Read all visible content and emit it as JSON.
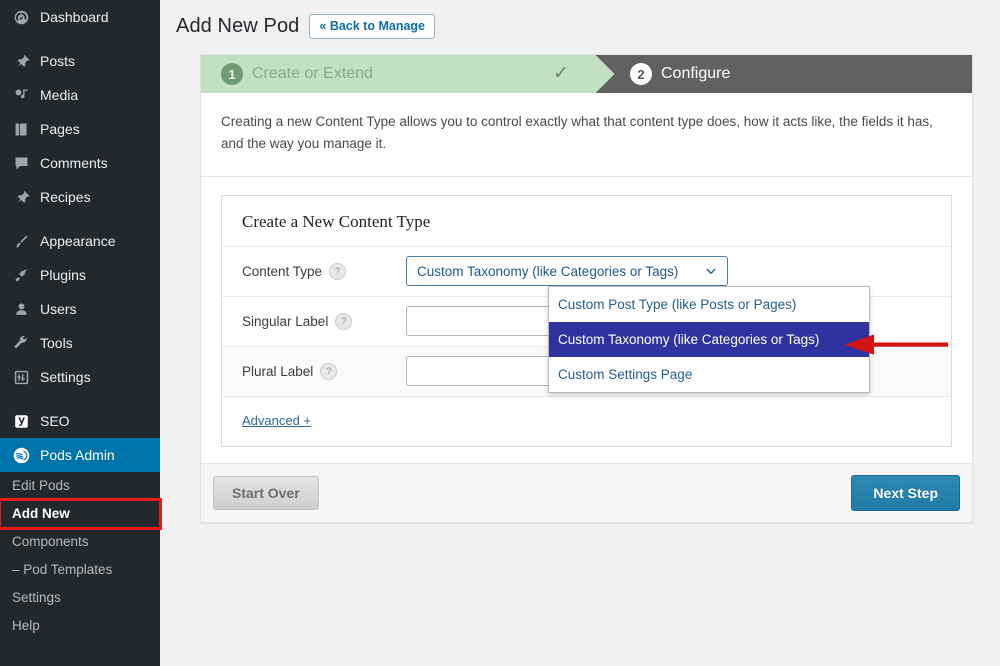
{
  "sidebar": {
    "items": [
      {
        "label": "Dashboard",
        "icon": "dashboard-icon"
      },
      {
        "label": "Posts",
        "icon": "pin-icon"
      },
      {
        "label": "Media",
        "icon": "media-icon"
      },
      {
        "label": "Pages",
        "icon": "pages-icon"
      },
      {
        "label": "Comments",
        "icon": "comment-icon"
      },
      {
        "label": "Recipes",
        "icon": "pin-icon"
      },
      {
        "label": "Appearance",
        "icon": "brush-icon"
      },
      {
        "label": "Plugins",
        "icon": "plug-icon"
      },
      {
        "label": "Users",
        "icon": "user-icon"
      },
      {
        "label": "Tools",
        "icon": "wrench-icon"
      },
      {
        "label": "Settings",
        "icon": "settings-icon"
      },
      {
        "label": "SEO",
        "icon": "yoast-seo-icon"
      },
      {
        "label": "Pods Admin",
        "icon": "pods-icon"
      }
    ],
    "submenu": [
      {
        "label": "Edit Pods"
      },
      {
        "label": "Add New"
      },
      {
        "label": "Components"
      },
      {
        "label": "– Pod Templates"
      },
      {
        "label": "Settings"
      },
      {
        "label": "Help"
      }
    ],
    "active_item": "Pods Admin",
    "active_subitem": "Add New",
    "highlight_color": "#e81b1b",
    "current_color": "#0073aa",
    "background": "#23282d"
  },
  "header": {
    "title": "Add New Pod",
    "back_button": "« Back to Manage"
  },
  "wizard": {
    "steps": [
      {
        "number": "1",
        "label": "Create or Extend",
        "state": "complete",
        "check": "✓"
      },
      {
        "number": "2",
        "label": "Configure",
        "state": "current"
      }
    ],
    "description": "Creating a new Content Type allows you to control exactly what that content type does, how it acts like, the fields it has, and the way you manage it.",
    "card_title": "Create a New Content Type",
    "fields": [
      {
        "label": "Content Type",
        "help": "?",
        "value": "Custom Taxonomy (like Categories or Tags)"
      },
      {
        "label": "Singular Label",
        "help": "?",
        "value": ""
      },
      {
        "label": "Plural Label",
        "help": "?",
        "value": ""
      }
    ],
    "advanced_link": "Advanced +",
    "buttons": {
      "start_over": "Start Over",
      "next_step": "Next Step"
    },
    "step_complete_color": "#c3e0c3",
    "step_current_color": "#616161",
    "next_button_color": "#1f7aa6"
  },
  "dropdown": {
    "open": true,
    "options": [
      "Custom Post Type (like Posts or Pages)",
      "Custom Taxonomy (like Categories or Tags)",
      "Custom Settings Page"
    ],
    "selected_index": 1,
    "selected_bg": "#2f33a0",
    "option_color": "#25608d"
  },
  "annotation": {
    "arrow_color": "#d31212",
    "points_to": "Custom Taxonomy (like Categories or Tags)"
  }
}
